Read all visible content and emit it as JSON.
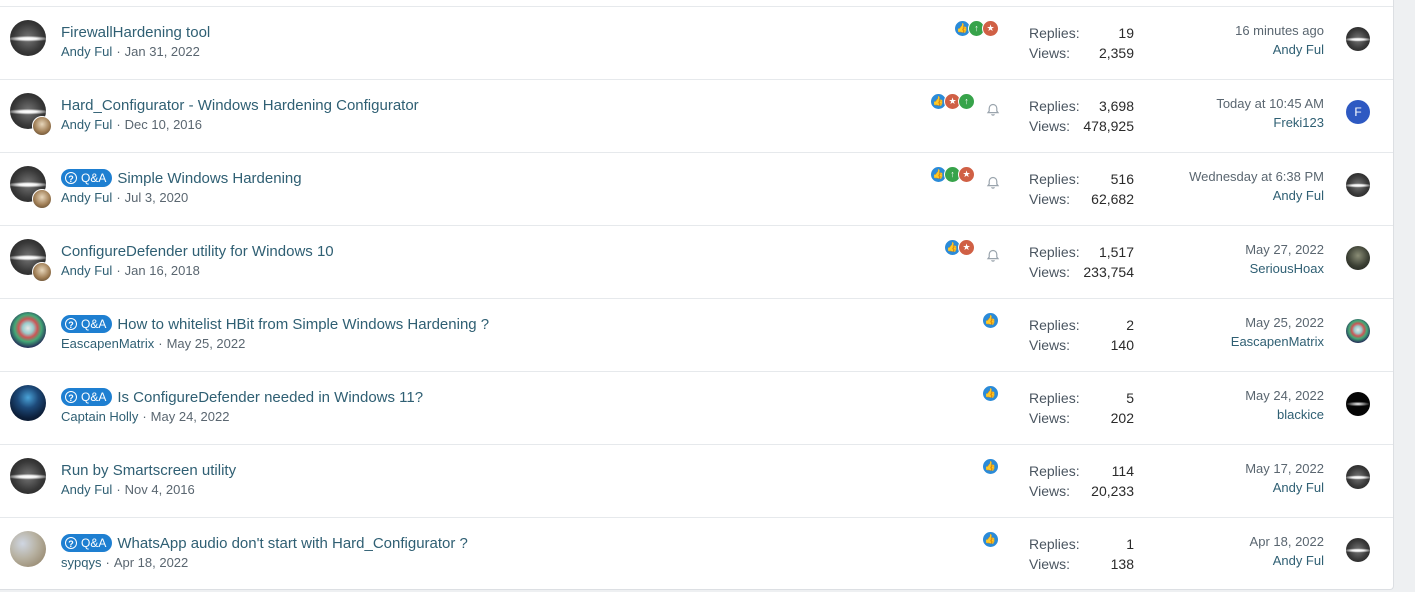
{
  "threads": [
    {
      "title": "FirewallHardening tool",
      "qa": false,
      "author": "Andy Ful",
      "date": "Jan 31, 2022",
      "avatar_style": "gray",
      "has_mini": false,
      "reactions": [
        "like",
        "up",
        "trophy"
      ],
      "watching": false,
      "replies_label": "Replies:",
      "replies": "19",
      "views_label": "Views:",
      "views": "2,359",
      "last_when": "16 minutes ago",
      "last_by": "Andy Ful",
      "last_avatar_style": "gray",
      "last_avatar_letter": ""
    },
    {
      "title": "Hard_Configurator - Windows Hardening Configurator",
      "qa": false,
      "author": "Andy Ful",
      "date": "Dec 10, 2016",
      "avatar_style": "gray",
      "has_mini": true,
      "reactions": [
        "like",
        "trophy",
        "up"
      ],
      "watching": true,
      "replies_label": "Replies:",
      "replies": "3,698",
      "views_label": "Views:",
      "views": "478,925",
      "last_when": "Today at 10:45 AM",
      "last_by": "Freki123",
      "last_avatar_style": "letter",
      "last_avatar_letter": "F"
    },
    {
      "title": "Simple Windows Hardening",
      "qa": true,
      "author": "Andy Ful",
      "date": "Jul 3, 2020",
      "avatar_style": "gray",
      "has_mini": true,
      "reactions": [
        "like",
        "up",
        "trophy"
      ],
      "watching": true,
      "replies_label": "Replies:",
      "replies": "516",
      "views_label": "Views:",
      "views": "62,682",
      "last_when": "Wednesday at 6:38 PM",
      "last_by": "Andy Ful",
      "last_avatar_style": "gray",
      "last_avatar_letter": ""
    },
    {
      "title": "ConfigureDefender utility for Windows 10",
      "qa": false,
      "author": "Andy Ful",
      "date": "Jan 16, 2018",
      "avatar_style": "gray",
      "has_mini": true,
      "reactions": [
        "like",
        "trophy"
      ],
      "watching": true,
      "replies_label": "Replies:",
      "replies": "1,517",
      "views_label": "Views:",
      "views": "233,754",
      "last_when": "May 27, 2022",
      "last_by": "SeriousHoax",
      "last_avatar_style": "dark",
      "last_avatar_letter": ""
    },
    {
      "title": "How to whitelist HBit from Simple Windows Hardening ?",
      "qa": true,
      "author": "EascapenMatrix",
      "date": "May 25, 2022",
      "avatar_style": "skull",
      "has_mini": false,
      "reactions": [
        "like"
      ],
      "watching": false,
      "replies_label": "Replies:",
      "replies": "2",
      "views_label": "Views:",
      "views": "140",
      "last_when": "May 25, 2022",
      "last_by": "EascapenMatrix",
      "last_avatar_style": "skull",
      "last_avatar_letter": ""
    },
    {
      "title": "Is ConfigureDefender needed in Windows 11?",
      "qa": true,
      "author": "Captain Holly",
      "date": "May 24, 2022",
      "avatar_style": "hood",
      "has_mini": false,
      "reactions": [
        "like"
      ],
      "watching": false,
      "replies_label": "Replies:",
      "replies": "5",
      "views_label": "Views:",
      "views": "202",
      "last_when": "May 24, 2022",
      "last_by": "blackice",
      "last_avatar_style": "black",
      "last_avatar_letter": ""
    },
    {
      "title": "Run by Smartscreen utility",
      "qa": false,
      "author": "Andy Ful",
      "date": "Nov 4, 2016",
      "avatar_style": "gray",
      "has_mini": false,
      "reactions": [
        "like"
      ],
      "watching": false,
      "replies_label": "Replies:",
      "replies": "114",
      "views_label": "Views:",
      "views": "20,233",
      "last_when": "May 17, 2022",
      "last_by": "Andy Ful",
      "last_avatar_style": "gray",
      "last_avatar_letter": ""
    },
    {
      "title": "WhatsApp audio don't start with Hard_Configurator ?",
      "qa": true,
      "author": "sypqys",
      "date": "Apr 18, 2022",
      "avatar_style": "sand",
      "has_mini": false,
      "reactions": [
        "like"
      ],
      "watching": false,
      "replies_label": "Replies:",
      "replies": "1",
      "views_label": "Views:",
      "views": "138",
      "last_when": "Apr 18, 2022",
      "last_by": "Andy Ful",
      "last_avatar_style": "gray",
      "last_avatar_letter": ""
    }
  ],
  "qa_badge_label": "Q&A",
  "meta_separator": "·",
  "colors": {
    "link": "#2f5f73",
    "muted": "#5a6670",
    "badge": "#1e7fd1",
    "like": "#2b8bd8",
    "upvote": "#37a34a",
    "trophy": "#d06045"
  }
}
